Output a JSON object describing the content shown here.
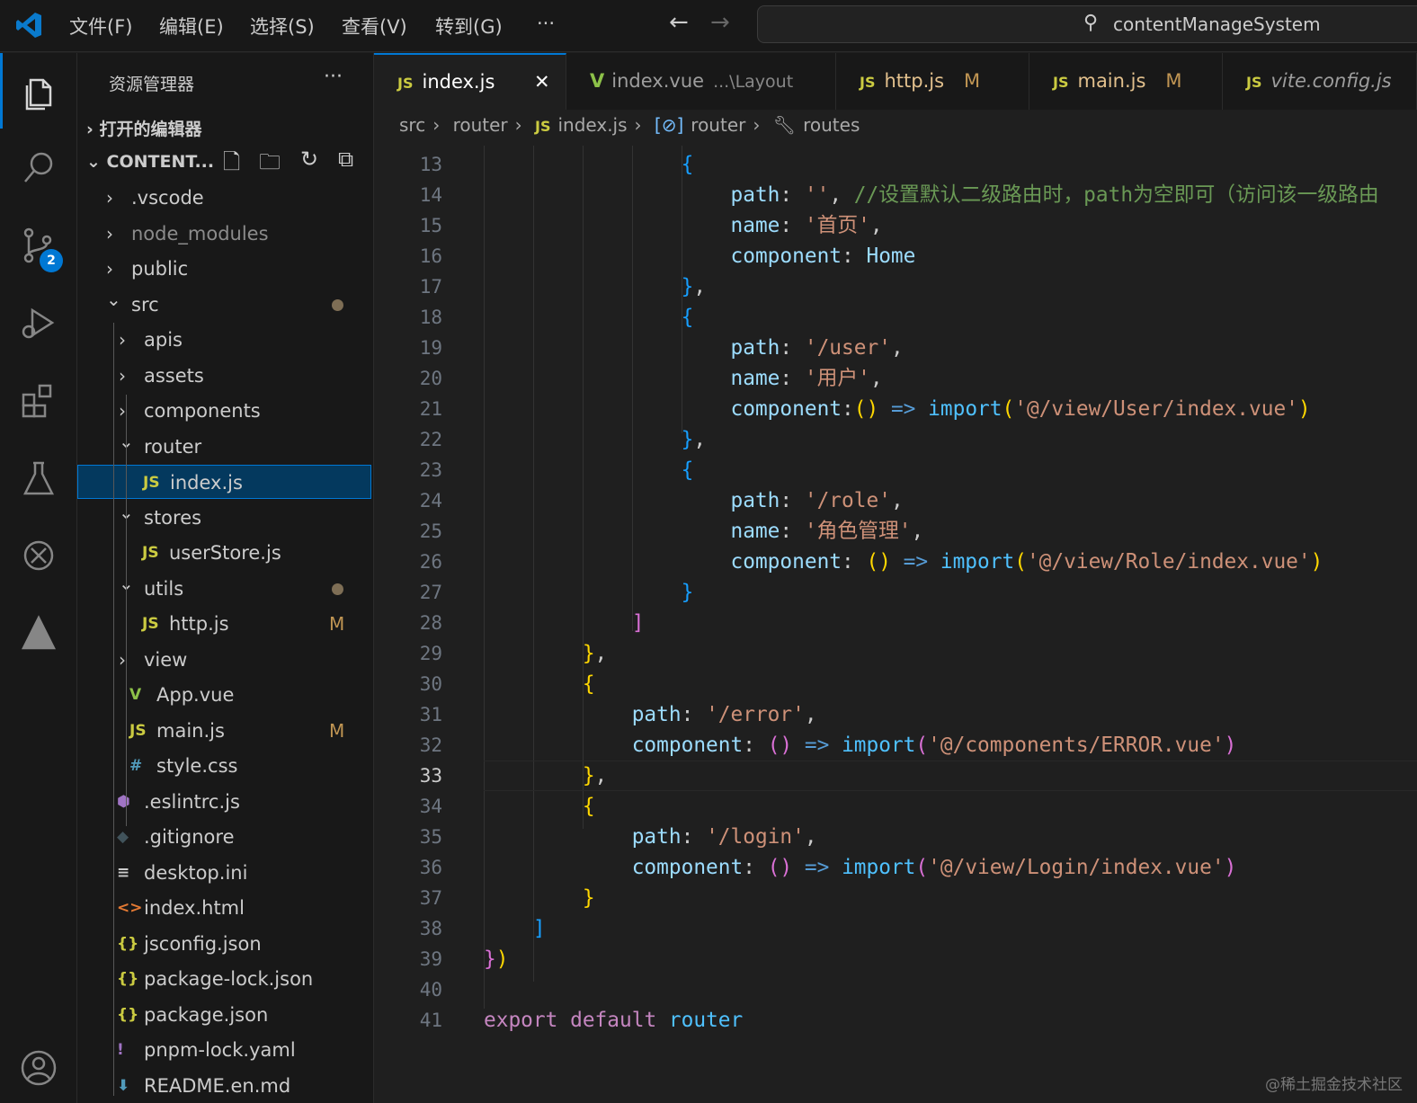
{
  "titlebar": {
    "menus": [
      "文件(F)",
      "编辑(E)",
      "选择(S)",
      "查看(V)",
      "转到(G)",
      "···"
    ],
    "search": "contentManageSystem"
  },
  "activity": {
    "scm_badge": "2"
  },
  "sidebar": {
    "title": "资源管理器",
    "more": "···",
    "open_editors": "打开的编辑器",
    "project": "CONTENT...",
    "tree": [
      {
        "label": ".vscode",
        "depth": 0,
        "type": "folder",
        "open": false
      },
      {
        "label": "node_modules",
        "depth": 0,
        "type": "folder",
        "open": false,
        "dim": true
      },
      {
        "label": "public",
        "depth": 0,
        "type": "folder",
        "open": false
      },
      {
        "label": "src",
        "depth": 0,
        "type": "folder",
        "open": true,
        "dot": true
      },
      {
        "label": "apis",
        "depth": 1,
        "type": "folder",
        "open": false
      },
      {
        "label": "assets",
        "depth": 1,
        "type": "folder",
        "open": false
      },
      {
        "label": "components",
        "depth": 1,
        "type": "folder",
        "open": false
      },
      {
        "label": "router",
        "depth": 1,
        "type": "folder",
        "open": true
      },
      {
        "label": "index.js",
        "depth": 2,
        "type": "js",
        "selected": true
      },
      {
        "label": "stores",
        "depth": 1,
        "type": "folder",
        "open": true
      },
      {
        "label": "userStore.js",
        "depth": 2,
        "type": "js"
      },
      {
        "label": "utils",
        "depth": 1,
        "type": "folder",
        "open": true,
        "dot": true
      },
      {
        "label": "http.js",
        "depth": 2,
        "type": "js",
        "status": "M"
      },
      {
        "label": "view",
        "depth": 1,
        "type": "folder",
        "open": false
      },
      {
        "label": "App.vue",
        "depth": 1,
        "type": "vue"
      },
      {
        "label": "main.js",
        "depth": 1,
        "type": "js",
        "status": "M"
      },
      {
        "label": "style.css",
        "depth": 1,
        "type": "css"
      },
      {
        "label": ".eslintrc.js",
        "depth": 0,
        "type": "eslint"
      },
      {
        "label": ".gitignore",
        "depth": 0,
        "type": "git"
      },
      {
        "label": "desktop.ini",
        "depth": 0,
        "type": "ini"
      },
      {
        "label": "index.html",
        "depth": 0,
        "type": "html"
      },
      {
        "label": "jsconfig.json",
        "depth": 0,
        "type": "json"
      },
      {
        "label": "package-lock.json",
        "depth": 0,
        "type": "json"
      },
      {
        "label": "package.json",
        "depth": 0,
        "type": "json"
      },
      {
        "label": "pnpm-lock.yaml",
        "depth": 0,
        "type": "yaml"
      },
      {
        "label": "README.en.md",
        "depth": 0,
        "type": "md"
      }
    ]
  },
  "tabs": [
    {
      "label": "index.js",
      "icon": "JS",
      "active": true,
      "close": "✕"
    },
    {
      "label": "index.vue",
      "icon": "V",
      "desc": "...\\Layout"
    },
    {
      "label": "http.js",
      "icon": "JS",
      "status": "M"
    },
    {
      "label": "main.js",
      "icon": "JS",
      "status": "M"
    },
    {
      "label": "vite.config.js",
      "icon": "JS",
      "italic": true
    }
  ],
  "breadcrumb": [
    "src",
    "router",
    "JS",
    "index.js",
    "router",
    "routes"
  ],
  "editor": {
    "current_line": 33,
    "lines": [
      {
        "n": 13,
        "t": [
          [
            "p",
            "                "
          ],
          [
            "b3",
            "{"
          ]
        ]
      },
      {
        "n": 14,
        "t": [
          [
            "p",
            "                    "
          ],
          [
            "k",
            "path"
          ],
          [
            "p",
            ": "
          ],
          [
            "s",
            "''"
          ],
          [
            "p",
            ", "
          ],
          [
            "c",
            "//设置默认二级路由时，path为空即可（访问该一级路由"
          ]
        ]
      },
      {
        "n": 15,
        "t": [
          [
            "p",
            "                    "
          ],
          [
            "k",
            "name"
          ],
          [
            "p",
            ": "
          ],
          [
            "s",
            "'首页'"
          ],
          [
            "p",
            ","
          ]
        ]
      },
      {
        "n": 16,
        "t": [
          [
            "p",
            "                    "
          ],
          [
            "k",
            "component"
          ],
          [
            "p",
            ": "
          ],
          [
            "v",
            "Home"
          ]
        ]
      },
      {
        "n": 17,
        "t": [
          [
            "p",
            "                "
          ],
          [
            "b3",
            "}"
          ],
          [
            "p",
            ","
          ]
        ]
      },
      {
        "n": 18,
        "t": [
          [
            "p",
            "                "
          ],
          [
            "b3",
            "{"
          ]
        ]
      },
      {
        "n": 19,
        "t": [
          [
            "p",
            "                    "
          ],
          [
            "k",
            "path"
          ],
          [
            "p",
            ": "
          ],
          [
            "s",
            "'/user'"
          ],
          [
            "p",
            ","
          ]
        ]
      },
      {
        "n": 20,
        "t": [
          [
            "p",
            "                    "
          ],
          [
            "k",
            "name"
          ],
          [
            "p",
            ": "
          ],
          [
            "s",
            "'用户'"
          ],
          [
            "p",
            ","
          ]
        ]
      },
      {
        "n": 21,
        "t": [
          [
            "p",
            "                    "
          ],
          [
            "k",
            "component"
          ],
          [
            "p",
            ":"
          ],
          [
            "b1",
            "()"
          ],
          [
            "p",
            " "
          ],
          [
            "ar",
            "=>"
          ],
          [
            "p",
            " "
          ],
          [
            "fn",
            "import"
          ],
          [
            "b1",
            "("
          ],
          [
            "s",
            "'@/view/User/index.vue'"
          ],
          [
            "b1",
            ")"
          ]
        ]
      },
      {
        "n": 22,
        "t": [
          [
            "p",
            "                "
          ],
          [
            "b3",
            "}"
          ],
          [
            "p",
            ","
          ]
        ]
      },
      {
        "n": 23,
        "t": [
          [
            "p",
            "                "
          ],
          [
            "b3",
            "{"
          ]
        ]
      },
      {
        "n": 24,
        "t": [
          [
            "p",
            "                    "
          ],
          [
            "k",
            "path"
          ],
          [
            "p",
            ": "
          ],
          [
            "s",
            "'/role'"
          ],
          [
            "p",
            ","
          ]
        ]
      },
      {
        "n": 25,
        "t": [
          [
            "p",
            "                    "
          ],
          [
            "k",
            "name"
          ],
          [
            "p",
            ": "
          ],
          [
            "s",
            "'角色管理'"
          ],
          [
            "p",
            ","
          ]
        ]
      },
      {
        "n": 26,
        "t": [
          [
            "p",
            "                    "
          ],
          [
            "k",
            "component"
          ],
          [
            "p",
            ": "
          ],
          [
            "b1",
            "()"
          ],
          [
            "p",
            " "
          ],
          [
            "ar",
            "=>"
          ],
          [
            "p",
            " "
          ],
          [
            "fn",
            "import"
          ],
          [
            "b1",
            "("
          ],
          [
            "s",
            "'@/view/Role/index.vue'"
          ],
          [
            "b1",
            ")"
          ]
        ]
      },
      {
        "n": 27,
        "t": [
          [
            "p",
            "                "
          ],
          [
            "b3",
            "}"
          ]
        ]
      },
      {
        "n": 28,
        "t": [
          [
            "p",
            "            "
          ],
          [
            "b2",
            "]"
          ]
        ]
      },
      {
        "n": 29,
        "t": [
          [
            "p",
            "        "
          ],
          [
            "b1",
            "}"
          ],
          [
            "p",
            ","
          ]
        ]
      },
      {
        "n": 30,
        "t": [
          [
            "p",
            "        "
          ],
          [
            "b1",
            "{"
          ]
        ]
      },
      {
        "n": 31,
        "t": [
          [
            "p",
            "            "
          ],
          [
            "k",
            "path"
          ],
          [
            "p",
            ": "
          ],
          [
            "s",
            "'/error'"
          ],
          [
            "p",
            ","
          ]
        ]
      },
      {
        "n": 32,
        "t": [
          [
            "p",
            "            "
          ],
          [
            "k",
            "component"
          ],
          [
            "p",
            ": "
          ],
          [
            "b2",
            "()"
          ],
          [
            "p",
            " "
          ],
          [
            "ar",
            "=>"
          ],
          [
            "p",
            " "
          ],
          [
            "fn",
            "import"
          ],
          [
            "b2",
            "("
          ],
          [
            "s",
            "'@/components/ERROR.vue'"
          ],
          [
            "b2",
            ")"
          ]
        ]
      },
      {
        "n": 33,
        "t": [
          [
            "p",
            "        "
          ],
          [
            "b1",
            "}"
          ],
          [
            "p",
            ","
          ]
        ]
      },
      {
        "n": 34,
        "t": [
          [
            "p",
            "        "
          ],
          [
            "b1",
            "{"
          ]
        ]
      },
      {
        "n": 35,
        "t": [
          [
            "p",
            "            "
          ],
          [
            "k",
            "path"
          ],
          [
            "p",
            ": "
          ],
          [
            "s",
            "'/login'"
          ],
          [
            "p",
            ","
          ]
        ]
      },
      {
        "n": 36,
        "t": [
          [
            "p",
            "            "
          ],
          [
            "k",
            "component"
          ],
          [
            "p",
            ": "
          ],
          [
            "b2",
            "()"
          ],
          [
            "p",
            " "
          ],
          [
            "ar",
            "=>"
          ],
          [
            "p",
            " "
          ],
          [
            "fn",
            "import"
          ],
          [
            "b2",
            "("
          ],
          [
            "s",
            "'@/view/Login/index.vue'"
          ],
          [
            "b2",
            ")"
          ]
        ]
      },
      {
        "n": 37,
        "t": [
          [
            "p",
            "        "
          ],
          [
            "b1",
            "}"
          ]
        ]
      },
      {
        "n": 38,
        "t": [
          [
            "p",
            "    "
          ],
          [
            "b3",
            "]"
          ]
        ]
      },
      {
        "n": 39,
        "t": [
          [
            "b2",
            "}"
          ],
          [
            "b1",
            ")"
          ]
        ]
      },
      {
        "n": 40,
        "t": []
      },
      {
        "n": 41,
        "t": [
          [
            "kw",
            "export"
          ],
          [
            "p",
            " "
          ],
          [
            "kw",
            "default"
          ],
          [
            "p",
            " "
          ],
          [
            "fn",
            "router"
          ]
        ]
      }
    ]
  },
  "watermark": "@稀土掘金技术社区",
  "colors": {
    "accent": "#0078d4",
    "js": "#cbcb41",
    "vue": "#8dc149",
    "modified": "#c09553"
  }
}
